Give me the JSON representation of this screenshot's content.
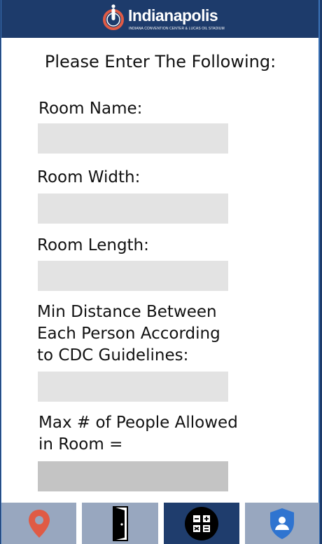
{
  "header": {
    "logo_word": "Indianapolis",
    "logo_subtitle": "INDIANA CONVENTION CENTER & LUCAS OIL STADIUM"
  },
  "form": {
    "heading": "Please Enter The Following:",
    "room_name_label": "Room Name:",
    "room_name_value": "",
    "room_width_label": "Room Width:",
    "room_width_value": "",
    "room_length_label": "Room Length:",
    "room_length_value": "",
    "min_distance_label": "Min Distance Between\nEach Person According\nto CDC Guidelines:",
    "min_distance_value": "",
    "max_people_label": "Max # of People Allowed\nin Room =",
    "max_people_value": ""
  },
  "nav": {
    "items": [
      {
        "icon": "map-pin-icon",
        "active": false
      },
      {
        "icon": "door-icon",
        "active": false
      },
      {
        "icon": "calculator-icon",
        "active": true
      },
      {
        "icon": "shield-user-icon",
        "active": false
      }
    ],
    "colors": {
      "inactive": "#98a7bf",
      "active": "#1f3d6d",
      "header": "#1d3b6b",
      "pin": "#e05b45",
      "shield": "#2f74d0"
    }
  }
}
